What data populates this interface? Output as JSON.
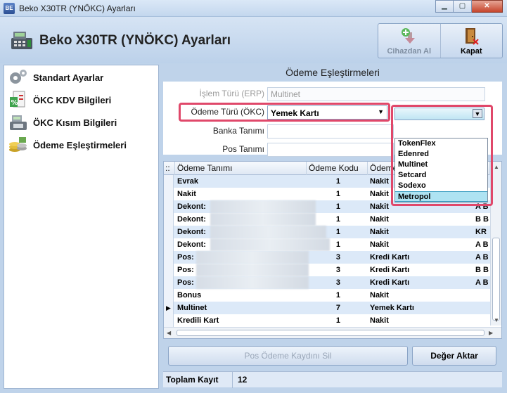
{
  "window": {
    "title": "Beko X30TR (YNÖKC) Ayarları",
    "app_icon_text": "BE"
  },
  "window_controls": {
    "minimize": "▁",
    "maximize": "▢",
    "close": "✕"
  },
  "header": {
    "heading": "Beko X30TR (YNÖKC) Ayarları",
    "buttons": [
      {
        "label": "Cihazdan Al",
        "icon": "download-icon",
        "enabled": false
      },
      {
        "label": "Kapat",
        "icon": "exit-door-icon",
        "enabled": true
      }
    ]
  },
  "nav": {
    "items": [
      {
        "label": "Standart Ayarlar",
        "icon": "gears-icon"
      },
      {
        "label": "ÖKC KDV Bilgileri",
        "icon": "percent-document-icon"
      },
      {
        "label": "ÖKC Kısım Bilgileri",
        "icon": "cash-register-icon"
      },
      {
        "label": "Ödeme Eşleştirmeleri",
        "icon": "coins-icon"
      }
    ]
  },
  "panel": {
    "title": "Ödeme Eşleştirmeleri",
    "form": {
      "islem_turu_label": "İşlem Türü (ERP)",
      "islem_turu_value": "Multinet",
      "odeme_turu_label": "Ödeme Türü (ÖKC)",
      "odeme_turu_value": "Yemek Kartı",
      "banka_label": "Banka Tanımı",
      "banka_value": "",
      "pos_label": "Pos Tanımı",
      "pos_value": ""
    },
    "dropdown": {
      "selected": "",
      "options": [
        "TokenFlex",
        "Edenred",
        "Multinet",
        "Setcard",
        "Sodexo",
        "Metropol"
      ],
      "highlighted_index": 5
    },
    "grid": {
      "columns": [
        "Ödeme Tanımı",
        "Ödeme Kodu",
        "Ödeme",
        ""
      ],
      "header_indicator": "::",
      "rows": [
        {
          "tanim": "Evrak",
          "kod": "1",
          "odeme": "Nakit",
          "extra": "",
          "blurred": false
        },
        {
          "tanim": "Nakit",
          "kod": "1",
          "odeme": "Nakit",
          "extra": "",
          "blurred": false
        },
        {
          "tanim": "Dekont:",
          "kod": "1",
          "odeme": "Nakit",
          "extra": "A B",
          "blurred": true
        },
        {
          "tanim": "Dekont:",
          "kod": "1",
          "odeme": "Nakit",
          "extra": "B B",
          "blurred": true
        },
        {
          "tanim": "Dekont:",
          "kod": "1",
          "odeme": "Nakit",
          "extra": "KR",
          "blurred": true
        },
        {
          "tanim": "Dekont:",
          "kod": "1",
          "odeme": "Nakit",
          "extra": "A B",
          "blurred": true
        },
        {
          "tanim": "Pos:",
          "kod": "3",
          "odeme": "Kredi Kartı",
          "extra": "A B",
          "blurred": true
        },
        {
          "tanim": "Pos:",
          "kod": "3",
          "odeme": "Kredi Kartı",
          "extra": "B B",
          "blurred": true
        },
        {
          "tanim": "Pos:",
          "kod": "3",
          "odeme": "Kredi Kartı",
          "extra": "A B",
          "blurred": true
        },
        {
          "tanim": "Bonus",
          "kod": "1",
          "odeme": "Nakit",
          "extra": "",
          "blurred": false
        },
        {
          "tanim": "Multinet",
          "kod": "7",
          "odeme": "Yemek Kartı",
          "extra": "",
          "blurred": false,
          "current": true
        },
        {
          "tanim": "Kredili Kart",
          "kod": "1",
          "odeme": "Nakit",
          "extra": "",
          "blurred": false
        }
      ],
      "current_row_marker": "▶"
    },
    "buttons": {
      "delete": "Pos Ödeme Kaydını Sil",
      "transfer": "Değer Aktar"
    },
    "status": {
      "label": "Toplam Kayıt",
      "value": "12"
    }
  },
  "colors": {
    "highlight_border": "#e0486a",
    "row_alt": "#dce9f8",
    "dropdown_selected": "#aee3f2"
  }
}
